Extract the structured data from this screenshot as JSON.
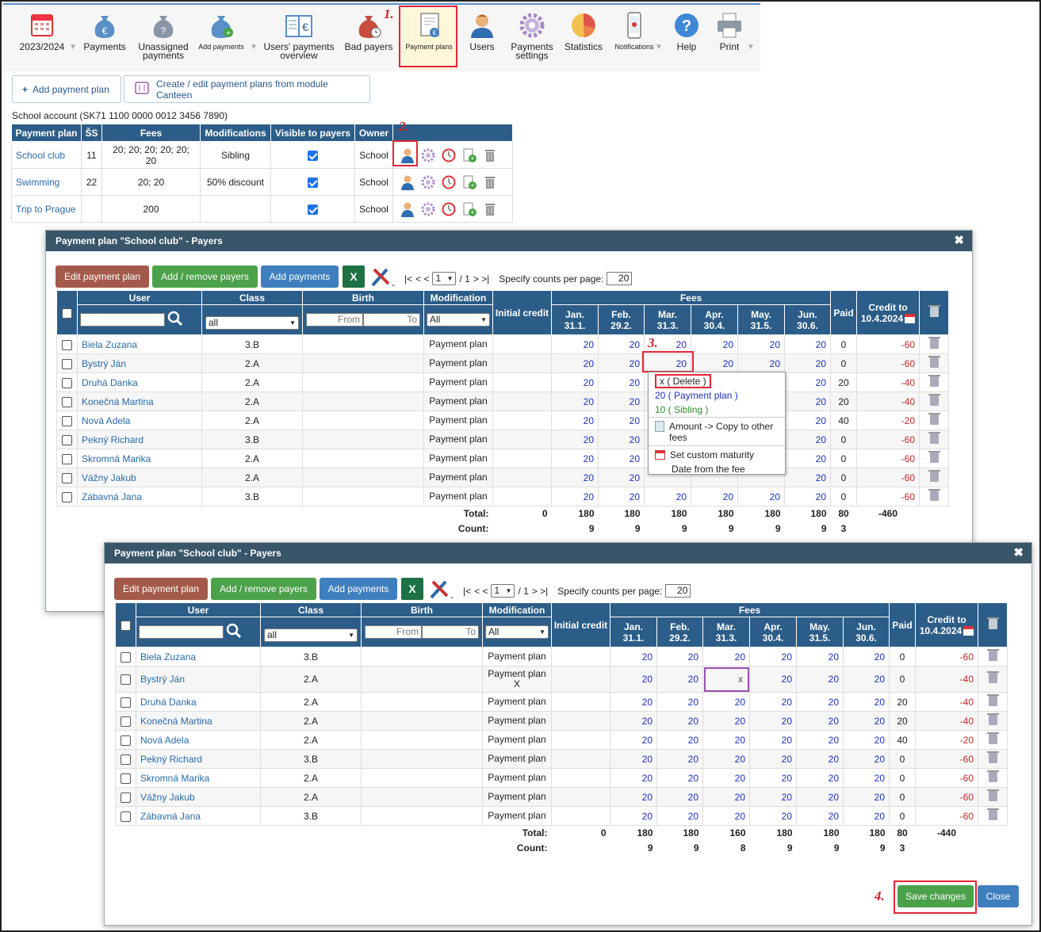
{
  "toolbar": {
    "items": [
      {
        "label": "2023/2024",
        "icon": "calendar-icon"
      },
      {
        "label": "Payments",
        "icon": "money-bag-icon"
      },
      {
        "label": "Unassigned payments",
        "icon": "money-bag-question-icon"
      },
      {
        "label": "Add payments",
        "icon": "money-bag-add-icon"
      },
      {
        "label": "Users' payments overview",
        "icon": "payments-book-icon"
      },
      {
        "label": "Bad payers",
        "icon": "money-bag-clock-icon"
      },
      {
        "label": "Payment plans",
        "icon": "payment-plan-icon"
      },
      {
        "label": "Users",
        "icon": "user-icon"
      },
      {
        "label": "Payments settings",
        "icon": "gear-icon"
      },
      {
        "label": "Statistics",
        "icon": "pie-chart-icon"
      },
      {
        "label": "Notifications",
        "icon": "phone-icon"
      },
      {
        "label": "Help",
        "icon": "help-icon"
      },
      {
        "label": "Print",
        "icon": "printer-icon"
      }
    ]
  },
  "steps": [
    "1.",
    "2.",
    "3.",
    "4."
  ],
  "actions": {
    "add_plan": "Add payment plan",
    "canteen": "Create / edit payment plans from module Canteen"
  },
  "account": "School account (SK71 1100 0000 0012 3456 7890)",
  "plans_table": {
    "headers": [
      "Payment plan",
      "ŠS",
      "Fees",
      "Modifications",
      "Visible to payers",
      "Owner",
      ""
    ],
    "rows": [
      {
        "name": "School club",
        "ss": "11",
        "fees": "20; 20; 20; 20; 20; 20",
        "mod": "Sibling",
        "visible": true,
        "owner": "School"
      },
      {
        "name": "Swimming",
        "ss": "22",
        "fees": "20; 20",
        "mod": "50% discount",
        "visible": true,
        "owner": "School"
      },
      {
        "name": "Trip to Prague",
        "ss": "",
        "fees": "200",
        "mod": "",
        "visible": true,
        "owner": "School"
      }
    ]
  },
  "dialog": {
    "title": "Payment plan \"School club\" - Payers",
    "edit_btn": "Edit payment plan",
    "add_remove_btn": "Add / remove payers",
    "add_payments_btn": "Add payments",
    "excel": "X",
    "pager_first": "|<",
    "pager_prev": "< <",
    "page": "1",
    "of": "/ 1",
    "pager_next": "> >|",
    "counts_label": "Specify counts per page:",
    "counts_value": "20",
    "col_user": "User",
    "col_class": "Class",
    "col_birth": "Birth",
    "col_mod": "Modification",
    "col_initial": "Initial credit",
    "col_fees": "Fees",
    "col_paid": "Paid",
    "col_credit1": "Credit to",
    "col_credit2": "10.4.2024",
    "class_filter": "all",
    "birth_from": "From",
    "birth_to": "To",
    "mod_filter": "All",
    "months": [
      [
        "Jan.",
        "31.1."
      ],
      [
        "Feb.",
        "29.2."
      ],
      [
        "Mar.",
        "31.3."
      ],
      [
        "Apr.",
        "30.4."
      ],
      [
        "May.",
        "31.5."
      ],
      [
        "Jun.",
        "30.6."
      ]
    ],
    "total_label": "Total:",
    "count_label": "Count:"
  },
  "grid1": {
    "rows": [
      {
        "user": "Biela Zuzana",
        "cls": "3.B",
        "mod": "Payment plan",
        "fees": [
          "20",
          "20",
          "20",
          "20",
          "20",
          "20"
        ],
        "paid": "0",
        "credit": "-60"
      },
      {
        "user": "Bystrý Ján",
        "cls": "2.A",
        "mod": "Payment plan",
        "fees": [
          "20",
          "20",
          "20",
          "20",
          "20",
          "20"
        ],
        "paid": "0",
        "credit": "-60"
      },
      {
        "user": "Druhá Danka",
        "cls": "2.A",
        "mod": "Payment plan",
        "fees": [
          "20",
          "20",
          "",
          "",
          "",
          "20"
        ],
        "paid": "20",
        "credit": "-40"
      },
      {
        "user": "Konečná Martina",
        "cls": "2.A",
        "mod": "Payment plan",
        "fees": [
          "20",
          "20",
          "",
          "",
          "",
          "20"
        ],
        "paid": "20",
        "credit": "-40"
      },
      {
        "user": "Nová Adela",
        "cls": "2.A",
        "mod": "Payment plan",
        "fees": [
          "20",
          "20",
          "",
          "",
          "",
          "20"
        ],
        "paid": "40",
        "credit": "-20"
      },
      {
        "user": "Pekný Richard",
        "cls": "3.B",
        "mod": "Payment plan",
        "fees": [
          "20",
          "20",
          "",
          "",
          "",
          "20"
        ],
        "paid": "0",
        "credit": "-60"
      },
      {
        "user": "Skromná Marika",
        "cls": "2.A",
        "mod": "Payment plan",
        "fees": [
          "20",
          "20",
          "",
          "",
          "",
          "20"
        ],
        "paid": "0",
        "credit": "-60"
      },
      {
        "user": "Vážny Jakub",
        "cls": "2.A",
        "mod": "Payment plan",
        "fees": [
          "20",
          "20",
          "",
          "",
          "",
          "20"
        ],
        "paid": "0",
        "credit": "-60"
      },
      {
        "user": "Zábavná Jana",
        "cls": "3.B",
        "mod": "Payment plan",
        "fees": [
          "20",
          "20",
          "20",
          "20",
          "20",
          "20"
        ],
        "paid": "0",
        "credit": "-60"
      }
    ],
    "total": {
      "initial": "0",
      "fees": [
        "180",
        "180",
        "180",
        "180",
        "180",
        "180"
      ],
      "paid": "80",
      "credit": "-460"
    },
    "count": {
      "fees": [
        "9",
        "9",
        "9",
        "9",
        "9",
        "9"
      ],
      "paid": "3"
    }
  },
  "context_menu": {
    "delete": "x  ( Delete )",
    "plan": "20  ( Payment plan )",
    "sibling": "10  ( Sibling )",
    "copy": "Amount -> Copy to other fees",
    "maturity": "Set custom maturity",
    "date_fee": "Date from the fee"
  },
  "grid2": {
    "rows": [
      {
        "user": "Biela Zuzana",
        "cls": "3.B",
        "mod": "Payment plan",
        "fees": [
          "20",
          "20",
          "20",
          "20",
          "20",
          "20"
        ],
        "paid": "0",
        "credit": "-60"
      },
      {
        "user": "Bystrý Ján",
        "cls": "2.A",
        "mod": "Payment plan",
        "mod2": "X",
        "fees": [
          "20",
          "20",
          "x",
          "20",
          "20",
          "20"
        ],
        "paid": "0",
        "credit": "-40"
      },
      {
        "user": "Druhá Danka",
        "cls": "2.A",
        "mod": "Payment plan",
        "fees": [
          "20",
          "20",
          "20",
          "20",
          "20",
          "20"
        ],
        "paid": "20",
        "credit": "-40"
      },
      {
        "user": "Konečná Martina",
        "cls": "2.A",
        "mod": "Payment plan",
        "fees": [
          "20",
          "20",
          "20",
          "20",
          "20",
          "20"
        ],
        "paid": "20",
        "credit": "-40"
      },
      {
        "user": "Nová Adela",
        "cls": "2.A",
        "mod": "Payment plan",
        "fees": [
          "20",
          "20",
          "20",
          "20",
          "20",
          "20"
        ],
        "paid": "40",
        "credit": "-20"
      },
      {
        "user": "Pekný Richard",
        "cls": "3.B",
        "mod": "Payment plan",
        "fees": [
          "20",
          "20",
          "20",
          "20",
          "20",
          "20"
        ],
        "paid": "0",
        "credit": "-60"
      },
      {
        "user": "Skromná Marika",
        "cls": "2.A",
        "mod": "Payment plan",
        "fees": [
          "20",
          "20",
          "20",
          "20",
          "20",
          "20"
        ],
        "paid": "0",
        "credit": "-60"
      },
      {
        "user": "Vážny Jakub",
        "cls": "2.A",
        "mod": "Payment plan",
        "fees": [
          "20",
          "20",
          "20",
          "20",
          "20",
          "20"
        ],
        "paid": "0",
        "credit": "-60"
      },
      {
        "user": "Zábavná Jana",
        "cls": "3.B",
        "mod": "Payment plan",
        "fees": [
          "20",
          "20",
          "20",
          "20",
          "20",
          "20"
        ],
        "paid": "0",
        "credit": "-60"
      }
    ],
    "total": {
      "initial": "0",
      "fees": [
        "180",
        "180",
        "160",
        "180",
        "180",
        "180"
      ],
      "paid": "80",
      "credit": "-440"
    },
    "count": {
      "fees": [
        "9",
        "9",
        "8",
        "9",
        "9",
        "9"
      ],
      "paid": "3"
    }
  },
  "footer": {
    "save": "Save changes",
    "close": "Close"
  },
  "colors": {
    "header_bg": "#2c5d88",
    "dialog_bar": "#395569",
    "highlight": "#e32636",
    "fee_blue": "#1f2fbf",
    "credit_red": "#c62828",
    "edited_cell": "#9b4fb0"
  }
}
